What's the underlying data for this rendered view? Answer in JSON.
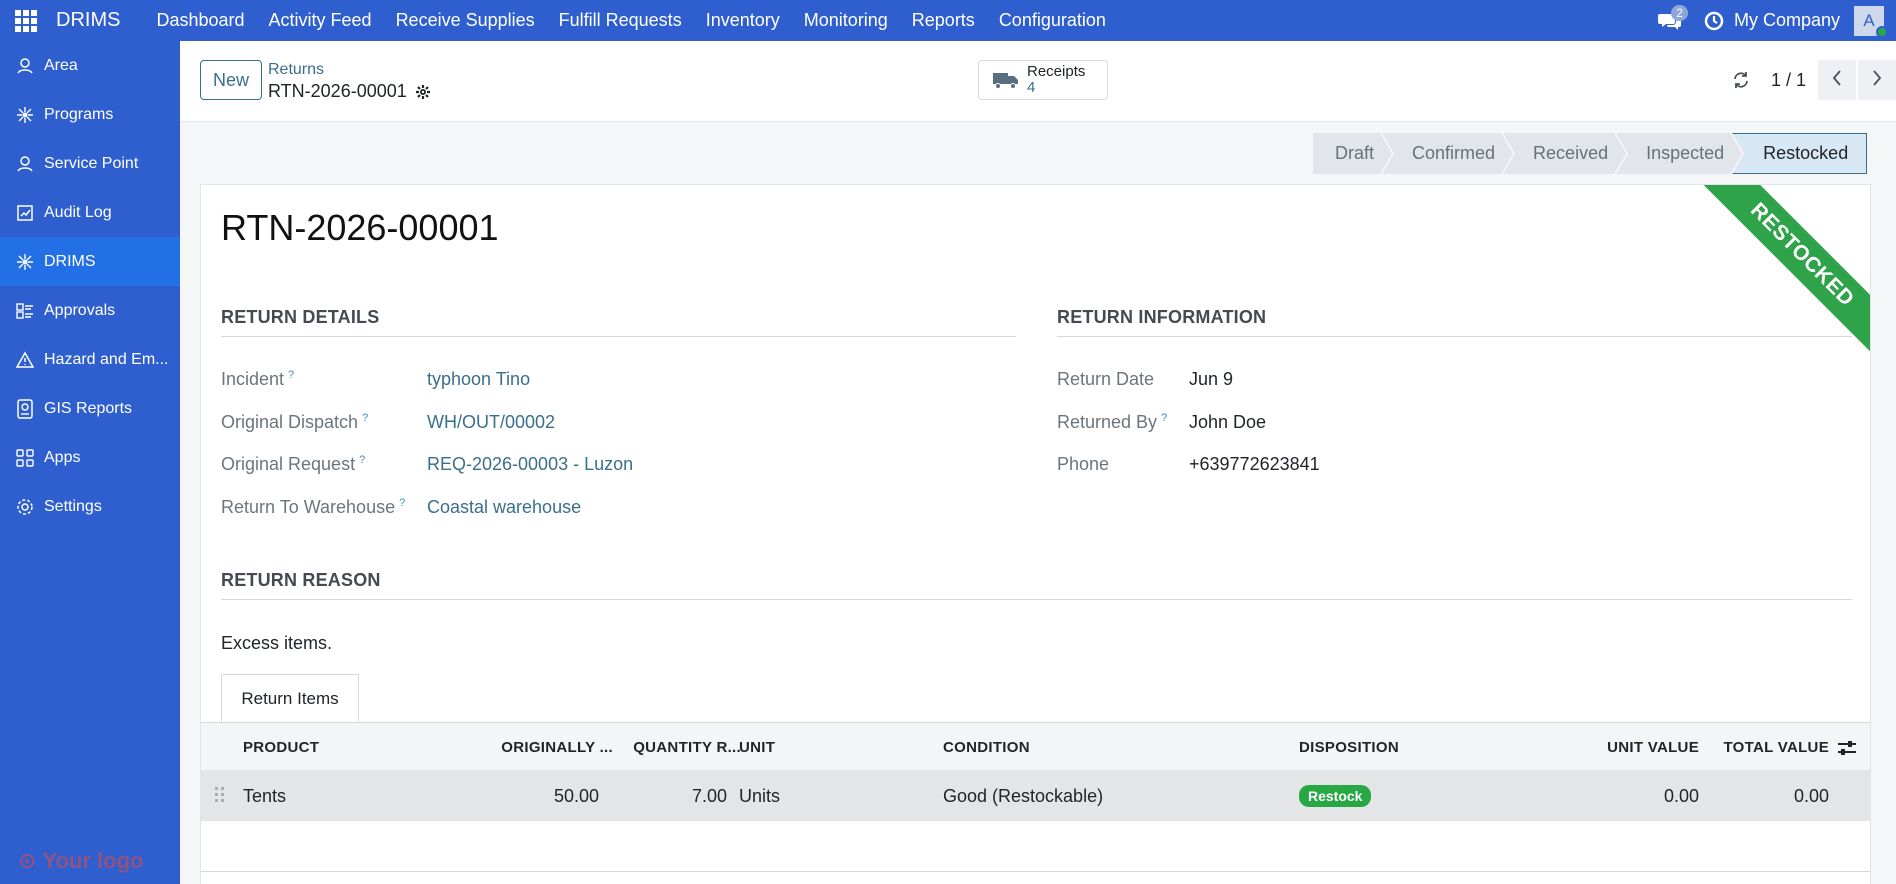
{
  "navbar": {
    "brand": "DRIMS",
    "menu": [
      "Dashboard",
      "Activity Feed",
      "Receive Supplies",
      "Fulfill Requests",
      "Inventory",
      "Monitoring",
      "Reports",
      "Configuration"
    ],
    "chat_count": "2",
    "company": "My Company",
    "avatar_initial": "A"
  },
  "sidebar": {
    "items": [
      {
        "label": "Area",
        "icon": "person-pin-icon"
      },
      {
        "label": "Programs",
        "icon": "network-icon"
      },
      {
        "label": "Service Point",
        "icon": "person-pin-icon"
      },
      {
        "label": "Audit Log",
        "icon": "chart-report-icon"
      },
      {
        "label": "DRIMS",
        "icon": "network-icon"
      },
      {
        "label": "Approvals",
        "icon": "checklist-icon"
      },
      {
        "label": "Hazard and Em...",
        "icon": "warning-icon"
      },
      {
        "label": "GIS Reports",
        "icon": "document-icon"
      },
      {
        "label": "Apps",
        "icon": "apps-icon"
      },
      {
        "label": "Settings",
        "icon": "gear-icon"
      }
    ],
    "active": "DRIMS",
    "logo_text": "Your logo"
  },
  "control": {
    "new_label": "New",
    "breadcrumb": "Returns",
    "record_name": "RTN-2026-00001",
    "smart_button": {
      "label": "Receipts",
      "count": "4",
      "icon": "truck-icon"
    },
    "pager": "1 / 1"
  },
  "statusbar": {
    "stages": [
      "Draft",
      "Confirmed",
      "Received",
      "Inspected",
      "Restocked"
    ],
    "current": "Restocked"
  },
  "record": {
    "title": "RTN-2026-00001",
    "ribbon": "RESTOCKED",
    "return_details_head": "RETURN DETAILS",
    "return_info_head": "RETURN INFORMATION",
    "return_reason_head": "RETURN REASON",
    "details": [
      {
        "label": "Incident",
        "value": "typhoon Tino"
      },
      {
        "label": "Original Dispatch",
        "value": "WH/OUT/00002"
      },
      {
        "label": "Original Request",
        "value": "REQ-2026-00003 - Luzon"
      },
      {
        "label": "Return To Warehouse",
        "value": "Coastal warehouse"
      }
    ],
    "info": [
      {
        "label": "Return Date",
        "value": "Jun 9"
      },
      {
        "label": "Returned By",
        "value": "John Doe"
      },
      {
        "label": "Phone",
        "value": "+639772623841"
      }
    ],
    "reason": "Excess items.",
    "tab_label": "Return Items"
  },
  "items_table": {
    "columns": [
      "PRODUCT",
      "ORIGINALLY ...",
      "QUANTITY R...",
      "UNIT",
      "CONDITION",
      "DISPOSITION",
      "UNIT VALUE",
      "TOTAL VALUE"
    ],
    "rows": [
      {
        "product": "Tents",
        "originally": "50.00",
        "quantity": "7.00",
        "unit": "Units",
        "condition": "Good (Restockable)",
        "disposition": "Restock",
        "unit_value": "0.00",
        "total_value": "0.00"
      }
    ]
  },
  "colors": {
    "navbar": "#2f5fce",
    "active_sidebar": "#2370e6",
    "ribbon": "#2fa34a",
    "link": "#3a6f8a",
    "badge": "#28a745"
  }
}
